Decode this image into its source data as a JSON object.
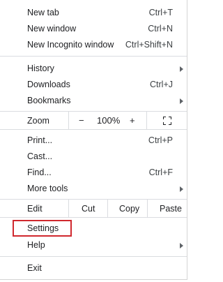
{
  "menu": {
    "group1": [
      {
        "label": "New tab",
        "shortcut": "Ctrl+T"
      },
      {
        "label": "New window",
        "shortcut": "Ctrl+N"
      },
      {
        "label": "New Incognito window",
        "shortcut": "Ctrl+Shift+N"
      }
    ],
    "group2": [
      {
        "label": "History",
        "shortcut": ""
      },
      {
        "label": "Downloads",
        "shortcut": "Ctrl+J"
      },
      {
        "label": "Bookmarks",
        "shortcut": ""
      }
    ],
    "zoom": {
      "label": "Zoom",
      "minus": "−",
      "value": "100%",
      "plus": "+",
      "fullscreen_icon": "fullscreen-icon"
    },
    "group3": [
      {
        "label": "Print...",
        "shortcut": "Ctrl+P"
      },
      {
        "label": "Cast...",
        "shortcut": ""
      },
      {
        "label": "Find...",
        "shortcut": "Ctrl+F"
      },
      {
        "label": "More tools",
        "shortcut": ""
      }
    ],
    "edit": {
      "label": "Edit",
      "cut": "Cut",
      "copy": "Copy",
      "paste": "Paste"
    },
    "group4": [
      {
        "label": "Settings",
        "shortcut": ""
      },
      {
        "label": "Help",
        "shortcut": ""
      }
    ],
    "group5": [
      {
        "label": "Exit",
        "shortcut": ""
      }
    ],
    "highlight_color": "#d0282e",
    "submenu_arrow_icon": "chevron-right-icon"
  }
}
